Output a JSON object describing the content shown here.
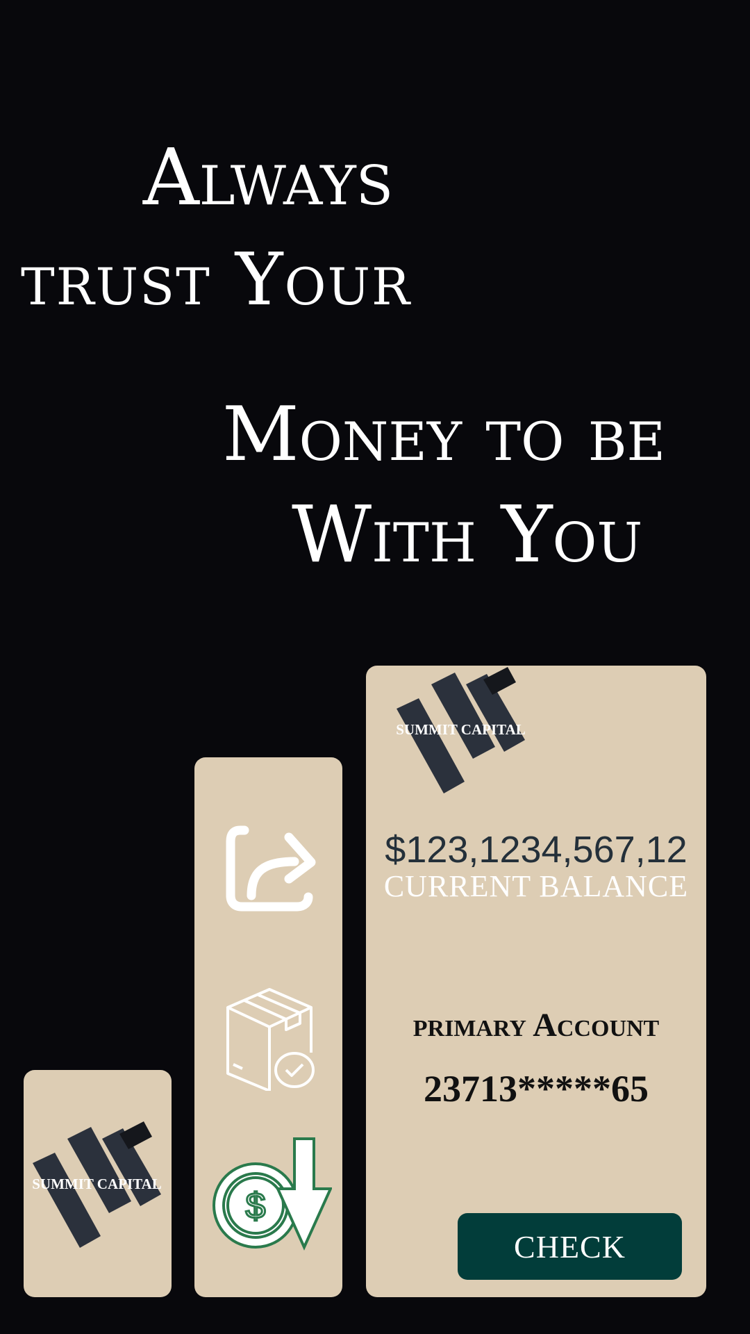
{
  "headline": {
    "line1": "Always",
    "line2": "trust Your",
    "line3": "Money to be",
    "line4": "With You"
  },
  "brand": {
    "name": "SUMMIT CAPITAL"
  },
  "actions": {
    "icons": [
      "share-icon",
      "package-check-icon",
      "coin-withdraw-icon"
    ]
  },
  "account": {
    "balance": "$123,1234,567,12",
    "balance_label": "CURRENT BALANCE",
    "account_label": "primary Account",
    "account_number": "23713*****65",
    "check_label": "CHECK"
  },
  "colors": {
    "background": "#08080c",
    "card": "#ddcdb4",
    "button": "#023d3a",
    "coin_green": "#2a7a4c"
  }
}
